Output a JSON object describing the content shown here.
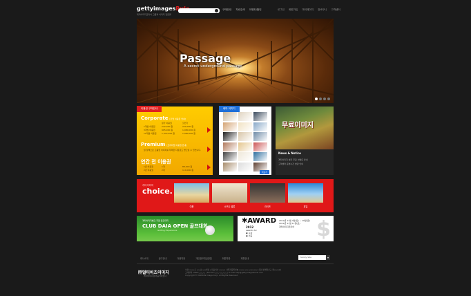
{
  "header": {
    "logo_main": "gettyimages",
    "logo_sub": "Bule",
    "logo_tagline": "게티이미지코리아 고품격 이미지 전문몰",
    "nav": [
      "구매안내",
      "자료검색",
      "이벤트/할인"
    ],
    "links": [
      "로그인",
      "회원가입",
      "마이페이지",
      "장바구니",
      "고객센터"
    ]
  },
  "hero": {
    "title": "Passage",
    "subtitle": "A secret underground passage",
    "slide_count": 4,
    "active_slide": 1
  },
  "pricing": {
    "tab": "이용권 구매안내",
    "corporate": {
      "title": "Corporate",
      "note": "[기업 이용권 안내]",
      "header": [
        "",
        "정가 이용권",
        "할인가"
      ],
      "rows": [
        [
          "1개월 이용권",
          "242,000 원",
          "220,000 원"
        ],
        [
          "3개월 이용권",
          "995,000 원",
          "1,980,000 원"
        ],
        [
          "12개월 이용권",
          "1,479,000 원",
          "1,980,000 원"
        ]
      ]
    },
    "premium": {
      "title": "Premium",
      "note": "[프리미엄 이용권 안내]",
      "desc": "월 정액으로 고품질 이미지를 무제한 다운로드 받으실 수 있습니다."
    },
    "annual": {
      "title": "연간 전 이용권",
      "rows": [
        [
          "1년 이용권",
          "1개",
          "88,000 원"
        ],
        [
          "2년 이용권",
          "2개",
          "110,000 원"
        ]
      ]
    }
  },
  "gallery": {
    "tab": "테마 이미지",
    "more": "더보기",
    "photo_colors": [
      "#c9b79c",
      "#e0d4c1",
      "#3a4a5c",
      "#d4a373",
      "#f1e2c3",
      "#88a8c8",
      "#1f1f1f",
      "#d8c6a8",
      "#6d8aa6",
      "#b0785a",
      "#e4c68d",
      "#c55",
      "#444",
      "#efe8da",
      "#2f6f9f",
      "#a68b6a",
      "#ddd",
      "#5c3d2e"
    ]
  },
  "freeimage": {
    "title": "무료이미지",
    "news_title": "News & Notice",
    "news": [
      "게티이미지 뱅크 무료 이벤트 안내",
      "고객센터 운영시간 변경 안내"
    ]
  },
  "choice": {
    "subtitle": "게티이미지",
    "title": "choice.",
    "items": [
      "여름",
      "소프트 밸류",
      "라이프",
      "휴일"
    ]
  },
  "golf": {
    "subtitle": "게티이미지뱅크 후원 골프대회",
    "title": "CLUB DAIA OPEN 골프대회",
    "title2": "Golfing Experience"
  },
  "award": {
    "title": "AWARD",
    "year": "2012",
    "lines": [
      "awards for",
      "▣ 수상",
      "▣ 인증"
    ],
    "info": [
      "2012년 11월 3일(토) ~ 10일(금)",
      "2012년 11월 17일(토)",
      "게티이미지코리아"
    ],
    "big": "$"
  },
  "footer": {
    "nav": [
      "회사소개",
      "광고안내",
      "이용약관",
      "개인정보취급방침",
      "회원약관",
      "제휴안내"
    ],
    "family_site": "family Site",
    "company": "㈜멀티비츠이미지",
    "company_sub": "게티이미지한국공식파트너",
    "address": [
      "서울시 ○○구 ○○로 ○○빌딩 | 대표이사 ○○○ | 사업자등록번호 ○○○-○○-○○○○○ | 통신판매업신고 제○○○호",
      "고객센터 1588-○○○○ | FAX 02-○○○-○○○○ | E-mail help@gettyimagesbank.com",
      "Copyright © Multibits Image Corp. All Rights Reserved."
    ]
  }
}
